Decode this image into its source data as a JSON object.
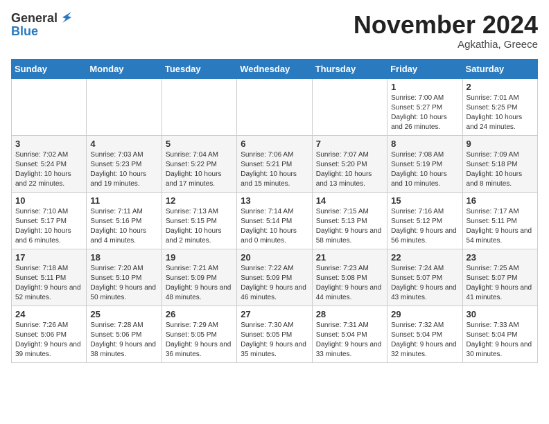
{
  "header": {
    "logo_line1": "General",
    "logo_line2": "Blue",
    "month": "November 2024",
    "location": "Agkathia, Greece"
  },
  "days_of_week": [
    "Sunday",
    "Monday",
    "Tuesday",
    "Wednesday",
    "Thursday",
    "Friday",
    "Saturday"
  ],
  "weeks": [
    [
      {
        "day": "",
        "info": ""
      },
      {
        "day": "",
        "info": ""
      },
      {
        "day": "",
        "info": ""
      },
      {
        "day": "",
        "info": ""
      },
      {
        "day": "",
        "info": ""
      },
      {
        "day": "1",
        "info": "Sunrise: 7:00 AM\nSunset: 5:27 PM\nDaylight: 10 hours and 26 minutes."
      },
      {
        "day": "2",
        "info": "Sunrise: 7:01 AM\nSunset: 5:25 PM\nDaylight: 10 hours and 24 minutes."
      }
    ],
    [
      {
        "day": "3",
        "info": "Sunrise: 7:02 AM\nSunset: 5:24 PM\nDaylight: 10 hours and 22 minutes."
      },
      {
        "day": "4",
        "info": "Sunrise: 7:03 AM\nSunset: 5:23 PM\nDaylight: 10 hours and 19 minutes."
      },
      {
        "day": "5",
        "info": "Sunrise: 7:04 AM\nSunset: 5:22 PM\nDaylight: 10 hours and 17 minutes."
      },
      {
        "day": "6",
        "info": "Sunrise: 7:06 AM\nSunset: 5:21 PM\nDaylight: 10 hours and 15 minutes."
      },
      {
        "day": "7",
        "info": "Sunrise: 7:07 AM\nSunset: 5:20 PM\nDaylight: 10 hours and 13 minutes."
      },
      {
        "day": "8",
        "info": "Sunrise: 7:08 AM\nSunset: 5:19 PM\nDaylight: 10 hours and 10 minutes."
      },
      {
        "day": "9",
        "info": "Sunrise: 7:09 AM\nSunset: 5:18 PM\nDaylight: 10 hours and 8 minutes."
      }
    ],
    [
      {
        "day": "10",
        "info": "Sunrise: 7:10 AM\nSunset: 5:17 PM\nDaylight: 10 hours and 6 minutes."
      },
      {
        "day": "11",
        "info": "Sunrise: 7:11 AM\nSunset: 5:16 PM\nDaylight: 10 hours and 4 minutes."
      },
      {
        "day": "12",
        "info": "Sunrise: 7:13 AM\nSunset: 5:15 PM\nDaylight: 10 hours and 2 minutes."
      },
      {
        "day": "13",
        "info": "Sunrise: 7:14 AM\nSunset: 5:14 PM\nDaylight: 10 hours and 0 minutes."
      },
      {
        "day": "14",
        "info": "Sunrise: 7:15 AM\nSunset: 5:13 PM\nDaylight: 9 hours and 58 minutes."
      },
      {
        "day": "15",
        "info": "Sunrise: 7:16 AM\nSunset: 5:12 PM\nDaylight: 9 hours and 56 minutes."
      },
      {
        "day": "16",
        "info": "Sunrise: 7:17 AM\nSunset: 5:11 PM\nDaylight: 9 hours and 54 minutes."
      }
    ],
    [
      {
        "day": "17",
        "info": "Sunrise: 7:18 AM\nSunset: 5:11 PM\nDaylight: 9 hours and 52 minutes."
      },
      {
        "day": "18",
        "info": "Sunrise: 7:20 AM\nSunset: 5:10 PM\nDaylight: 9 hours and 50 minutes."
      },
      {
        "day": "19",
        "info": "Sunrise: 7:21 AM\nSunset: 5:09 PM\nDaylight: 9 hours and 48 minutes."
      },
      {
        "day": "20",
        "info": "Sunrise: 7:22 AM\nSunset: 5:09 PM\nDaylight: 9 hours and 46 minutes."
      },
      {
        "day": "21",
        "info": "Sunrise: 7:23 AM\nSunset: 5:08 PM\nDaylight: 9 hours and 44 minutes."
      },
      {
        "day": "22",
        "info": "Sunrise: 7:24 AM\nSunset: 5:07 PM\nDaylight: 9 hours and 43 minutes."
      },
      {
        "day": "23",
        "info": "Sunrise: 7:25 AM\nSunset: 5:07 PM\nDaylight: 9 hours and 41 minutes."
      }
    ],
    [
      {
        "day": "24",
        "info": "Sunrise: 7:26 AM\nSunset: 5:06 PM\nDaylight: 9 hours and 39 minutes."
      },
      {
        "day": "25",
        "info": "Sunrise: 7:28 AM\nSunset: 5:06 PM\nDaylight: 9 hours and 38 minutes."
      },
      {
        "day": "26",
        "info": "Sunrise: 7:29 AM\nSunset: 5:05 PM\nDaylight: 9 hours and 36 minutes."
      },
      {
        "day": "27",
        "info": "Sunrise: 7:30 AM\nSunset: 5:05 PM\nDaylight: 9 hours and 35 minutes."
      },
      {
        "day": "28",
        "info": "Sunrise: 7:31 AM\nSunset: 5:04 PM\nDaylight: 9 hours and 33 minutes."
      },
      {
        "day": "29",
        "info": "Sunrise: 7:32 AM\nSunset: 5:04 PM\nDaylight: 9 hours and 32 minutes."
      },
      {
        "day": "30",
        "info": "Sunrise: 7:33 AM\nSunset: 5:04 PM\nDaylight: 9 hours and 30 minutes."
      }
    ]
  ]
}
